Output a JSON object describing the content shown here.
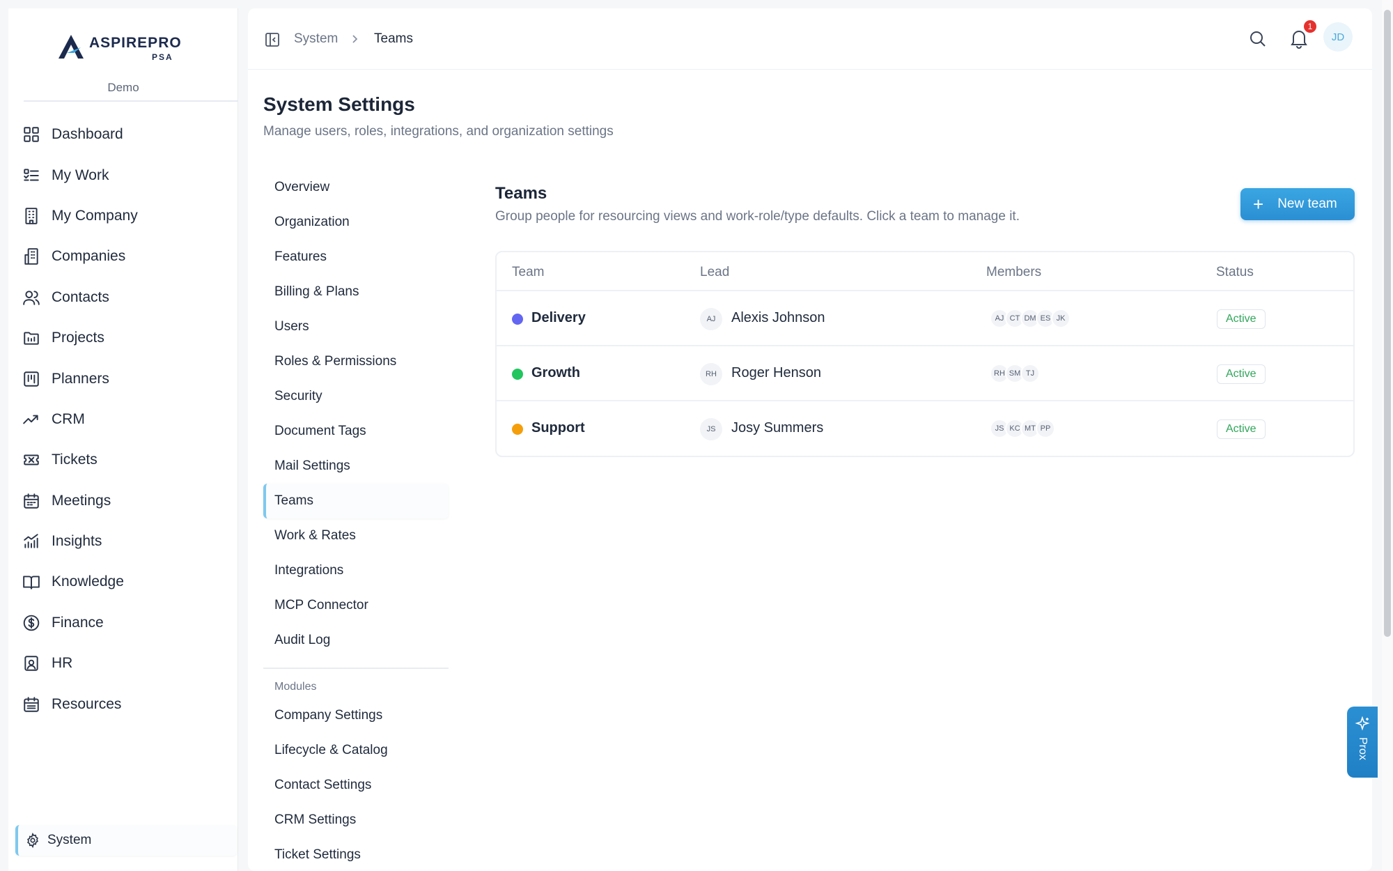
{
  "brand": {
    "name": "ASPIREPRO",
    "sub": "PSA",
    "org": "Demo"
  },
  "sidebar": {
    "items": [
      {
        "label": "Dashboard",
        "icon": "grid-icon"
      },
      {
        "label": "My Work",
        "icon": "checklist-icon"
      },
      {
        "label": "My Company",
        "icon": "building-icon"
      },
      {
        "label": "Companies",
        "icon": "buildings-icon"
      },
      {
        "label": "Contacts",
        "icon": "users-icon"
      },
      {
        "label": "Projects",
        "icon": "folder-icon"
      },
      {
        "label": "Planners",
        "icon": "kanban-icon"
      },
      {
        "label": "CRM",
        "icon": "trend-icon"
      },
      {
        "label": "Tickets",
        "icon": "ticket-icon"
      },
      {
        "label": "Meetings",
        "icon": "calendar-icon"
      },
      {
        "label": "Insights",
        "icon": "chart-icon"
      },
      {
        "label": "Knowledge",
        "icon": "book-icon"
      },
      {
        "label": "Finance",
        "icon": "dollar-icon"
      },
      {
        "label": "HR",
        "icon": "id-badge-icon"
      },
      {
        "label": "Resources",
        "icon": "calendar-grid-icon"
      }
    ],
    "system": "System"
  },
  "topbar": {
    "breadcrumb": [
      "System",
      "Teams"
    ],
    "notifications": "1",
    "user_initials": "JD"
  },
  "page": {
    "title": "System Settings",
    "subtitle": "Manage users, roles, integrations, and organization settings"
  },
  "settings_nav": {
    "items": [
      "Overview",
      "Organization",
      "Features",
      "Billing & Plans",
      "Users",
      "Roles & Permissions",
      "Security",
      "Document Tags",
      "Mail Settings",
      "Teams",
      "Work & Rates",
      "Integrations",
      "MCP Connector",
      "Audit Log"
    ],
    "active": "Teams",
    "modules_heading": "Modules",
    "modules": [
      "Company Settings",
      "Lifecycle & Catalog",
      "Contact Settings",
      "CRM Settings",
      "Ticket Settings"
    ]
  },
  "teams": {
    "title": "Teams",
    "subtitle": "Group people for resourcing views and work-role/type defaults. Click a team to manage it.",
    "new_button": "New team",
    "columns": [
      "Team",
      "Lead",
      "Members",
      "Status"
    ],
    "rows": [
      {
        "name": "Delivery",
        "color": "#6366f1",
        "lead_initials": "AJ",
        "lead": "Alexis Johnson",
        "members": [
          "AJ",
          "CT",
          "DM",
          "ES",
          "JK"
        ],
        "status": "Active"
      },
      {
        "name": "Growth",
        "color": "#22c55e",
        "lead_initials": "RH",
        "lead": "Roger Henson",
        "members": [
          "RH",
          "SM",
          "TJ"
        ],
        "status": "Active"
      },
      {
        "name": "Support",
        "color": "#f59e0b",
        "lead_initials": "JS",
        "lead": "Josy Summers",
        "members": [
          "JS",
          "KC",
          "MT",
          "PP"
        ],
        "status": "Active"
      }
    ]
  },
  "assistant": {
    "label": "Prox"
  },
  "colors": {
    "accent": "#2b8fd3",
    "active_border": "#7ec8ef",
    "status_green": "#2fa65a",
    "badge_red": "#e5312d"
  }
}
